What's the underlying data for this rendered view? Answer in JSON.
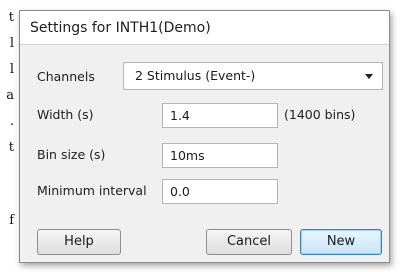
{
  "backdrop": {
    "fragments": [
      "t",
      "l",
      "l",
      "a",
      ".",
      "t",
      "f"
    ]
  },
  "dialog": {
    "title": "Settings for INTH1(Demo)",
    "channels": {
      "label": "Channels",
      "value": "2 Stimulus (Event-)"
    },
    "width": {
      "label": "Width (s)",
      "value": "1.4",
      "note": "(1400 bins)"
    },
    "bin_size": {
      "label": "Bin size (s)",
      "value": "10ms"
    },
    "min_interval": {
      "label": "Minimum interval",
      "value": "0.0"
    },
    "buttons": {
      "help": "Help",
      "cancel": "Cancel",
      "new": "New"
    }
  }
}
